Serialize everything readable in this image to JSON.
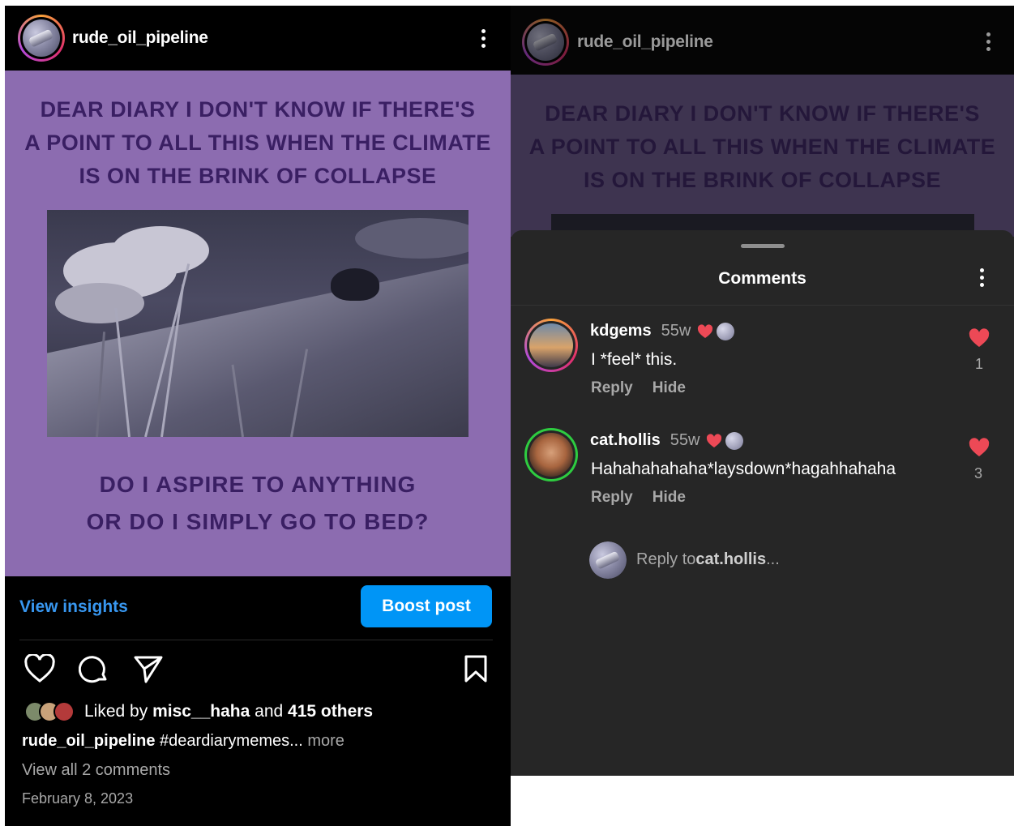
{
  "left": {
    "header": {
      "username": "rude_oil_pipeline"
    },
    "post": {
      "top_text": [
        "DEAR DIARY I DON'T KNOW IF THERE'S",
        "A POINT TO ALL THIS WHEN THE CLIMATE",
        "IS ON THE BRINK OF COLLAPSE"
      ],
      "bottom_text": [
        "DO I ASPIRE TO ANYTHING",
        "OR DO I SIMPLY GO TO BED?"
      ],
      "bg_color": "#8c6cb0",
      "text_color": "#3a1f63"
    },
    "insights_label": "View insights",
    "boost_label": "Boost post",
    "liked": {
      "prefix": "Liked by ",
      "user": "misc__haha",
      "mid": " and ",
      "count": "415 others"
    },
    "caption": {
      "user": "rude_oil_pipeline",
      "text": " #deardiarymemes...",
      "more": " more"
    },
    "view_all": "View all 2 comments",
    "date": "February 8, 2023"
  },
  "right": {
    "header": {
      "username": "rude_oil_pipeline"
    },
    "post": {
      "top_text": [
        "DEAR DIARY I DON'T KNOW IF THERE'S",
        "A POINT TO ALL THIS WHEN THE CLIMATE",
        "IS ON THE BRINK OF COLLAPSE"
      ]
    },
    "sheet_title": "Comments",
    "comments": [
      {
        "user": "kdgems",
        "time": "55w",
        "text": "I *feel* this.",
        "reply": "Reply",
        "hide": "Hide",
        "likes": "1"
      },
      {
        "user": "cat.hollis",
        "time": "55w",
        "text": "Hahahahahaha*laysdown*hagahhahaha",
        "reply": "Reply",
        "hide": "Hide",
        "likes": "3"
      }
    ],
    "reply_field": {
      "prefix": "Reply to ",
      "user": "cat.hollis",
      "suffix": "..."
    }
  },
  "colors": {
    "accent": "#0095f6",
    "link": "#3897f0",
    "heart": "#ed4956"
  }
}
